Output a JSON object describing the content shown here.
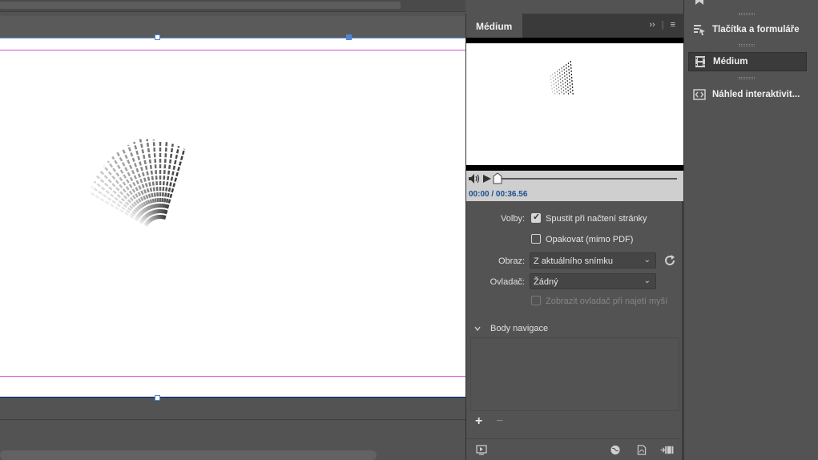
{
  "panel": {
    "tab_label": "Médium",
    "menu_collapse": "››",
    "menu_flyout": "≡",
    "timecode": "00:00 / 00:36.56",
    "options": {
      "volby_label": "Volby:",
      "autoplay_label": "Spustit při načtení stránky",
      "autoplay_checked": true,
      "loop_label": "Opakovat (mimo PDF)",
      "loop_checked": false,
      "obraz_label": "Obraz:",
      "obraz_value": "Z aktuálního snímku",
      "ovladac_label": "Ovladač:",
      "ovladac_value": "Žádný",
      "show_controller_label": "Zobrazit ovladač při najetí myší",
      "show_controller_enabled": false
    },
    "nav_points_label": "Body navigace",
    "add_label": "+",
    "remove_label": "−"
  },
  "dock": {
    "items": [
      {
        "label": "Tlačítka a formuláře",
        "icon": "buttons-forms-icon",
        "active": false
      },
      {
        "label": "Médium",
        "icon": "media-icon",
        "active": true
      },
      {
        "label": "Náhled interaktivit...",
        "icon": "preview-interactivity-icon",
        "active": false
      }
    ]
  },
  "colors": {
    "selection": "#4f85d6",
    "margin_guide": "#d14fd1",
    "timecode": "#1a5090"
  }
}
